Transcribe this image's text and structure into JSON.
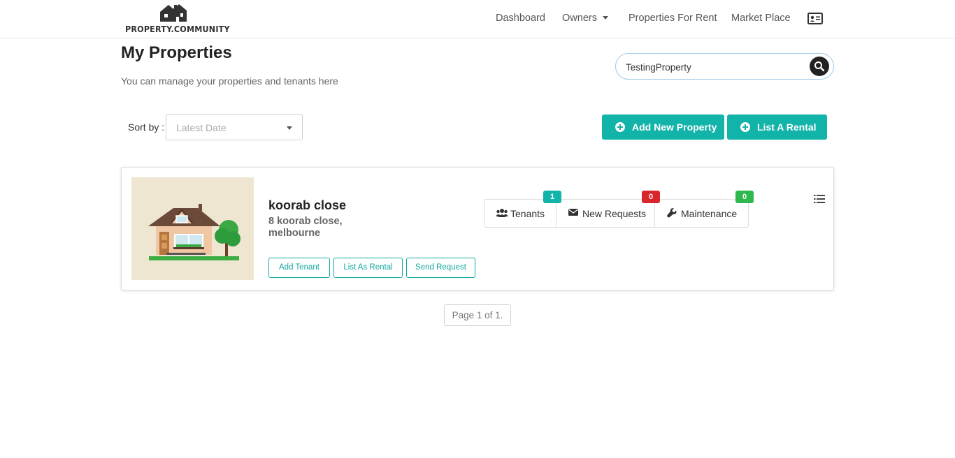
{
  "brand": {
    "logo_text": "PROPERTY.COMMUNITY"
  },
  "nav": {
    "dashboard": "Dashboard",
    "owners": "Owners",
    "properties_for_rent": "Properties For Rent",
    "market_place": "Market Place",
    "profile_icon": "id-card-icon"
  },
  "header": {
    "title": "My Properties",
    "subtitle": "You can manage your properties and tenants here"
  },
  "search": {
    "value": "TestingProperty",
    "icon": "search-icon"
  },
  "sort": {
    "label": "Sort by :",
    "selected": "Latest Date"
  },
  "actions": {
    "add_property": "Add New Property",
    "list_rental": "List A Rental"
  },
  "property": {
    "name": "koorab close",
    "address_line1": "8 koorab close,",
    "address_line2": "melbourne",
    "buttons": {
      "add_tenant": "Add Tenant",
      "list_as_rental": "List As Rental",
      "send_request": "Send Request"
    },
    "stats": {
      "tenants": {
        "label": "Tenants",
        "count": "1"
      },
      "new_requests": {
        "label": "New Requests",
        "count": "0"
      },
      "maintenance": {
        "label": "Maintenance",
        "count": "0"
      }
    }
  },
  "pagination": {
    "text": "Page 1 of 1."
  },
  "colors": {
    "accent": "#12b3a8",
    "danger": "#d9262c",
    "success": "#2eb84e"
  }
}
